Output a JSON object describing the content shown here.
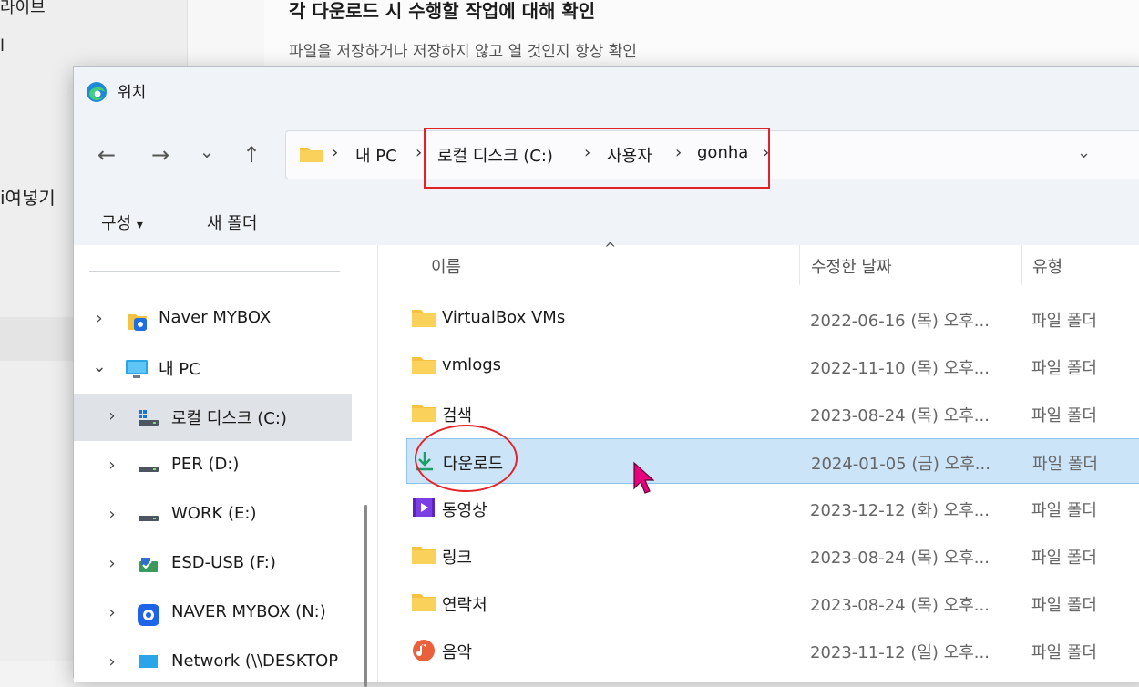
{
  "background": {
    "sidebar_top_text": "라이브",
    "sidebar_mid_text": "l",
    "sidebar_paste_text": "ⅰ여넣기",
    "setting_title": "각 다운로드 시 수행할 작업에 대해 확인",
    "setting_description": "파일을 저장하거나 저장하지 않고 열 것인지 항상 확인"
  },
  "dialog": {
    "title": "위치",
    "nav": {
      "back_glyph": "←",
      "forward_glyph": "→",
      "recent_glyph": "⌄",
      "up_glyph": "↑"
    },
    "address": {
      "separator": "›",
      "crumbs": [
        "내 PC",
        "로컬 디스크 (C:)",
        "사용자",
        "gonha"
      ],
      "dropdown_glyph": "⌄"
    },
    "toolbar": {
      "organize_label": "구성",
      "organize_caret": "▾",
      "new_folder_label": "새 폴더"
    },
    "nav_pane": {
      "items": [
        {
          "label": "Naver MYBOX",
          "chevron": "›",
          "icon": "mybox-icon"
        },
        {
          "label": "내 PC",
          "chevron": "⌄",
          "icon": "pc-icon"
        },
        {
          "label": "로컬 디스크 (C:)",
          "chevron": "›",
          "icon": "local-disk-icon"
        },
        {
          "label": "PER (D:)",
          "chevron": "›",
          "icon": "drive-icon"
        },
        {
          "label": "WORK (E:)",
          "chevron": "›",
          "icon": "drive-icon"
        },
        {
          "label": "ESD-USB (F:)",
          "chevron": "›",
          "icon": "usb-drive-icon"
        },
        {
          "label": "NAVER MYBOX (N:)",
          "chevron": "›",
          "icon": "naver-mybox-drive-icon"
        },
        {
          "label": "Network (\\\\DESKTOP",
          "chevron": "›",
          "icon": "network-icon"
        }
      ]
    },
    "file_list": {
      "sort_indicator": "^",
      "columns": {
        "name": "이름",
        "date": "수정한 날짜",
        "type": "유형"
      },
      "rows": [
        {
          "name": "VirtualBox VMs",
          "date": "2022-06-16 (목) 오후...",
          "type": "파일 폴더",
          "icon": "folder-icon"
        },
        {
          "name": "vmlogs",
          "date": "2022-11-10 (목) 오후...",
          "type": "파일 폴더",
          "icon": "folder-icon"
        },
        {
          "name": "검색",
          "date": "2023-08-24 (목) 오후...",
          "type": "파일 폴더",
          "icon": "folder-icon"
        },
        {
          "name": "다운로드",
          "date": "2024-01-05 (금) 오후...",
          "type": "파일 폴더",
          "icon": "download-icon"
        },
        {
          "name": "동영상",
          "date": "2023-12-12 (화) 오후...",
          "type": "파일 폴더",
          "icon": "video-icon"
        },
        {
          "name": "링크",
          "date": "2023-08-24 (목) 오후...",
          "type": "파일 폴더",
          "icon": "folder-icon"
        },
        {
          "name": "연락처",
          "date": "2023-08-24 (목) 오후...",
          "type": "파일 폴더",
          "icon": "folder-icon"
        },
        {
          "name": "음악",
          "date": "2023-11-12 (일) 오후...",
          "type": "파일 폴더",
          "icon": "music-icon"
        }
      ]
    }
  },
  "colors": {
    "annotation_red": "#e22326",
    "selection_blue": "#cce4f7",
    "folder_yellow": "#f5c242",
    "cursor_magenta": "#e6007e"
  }
}
